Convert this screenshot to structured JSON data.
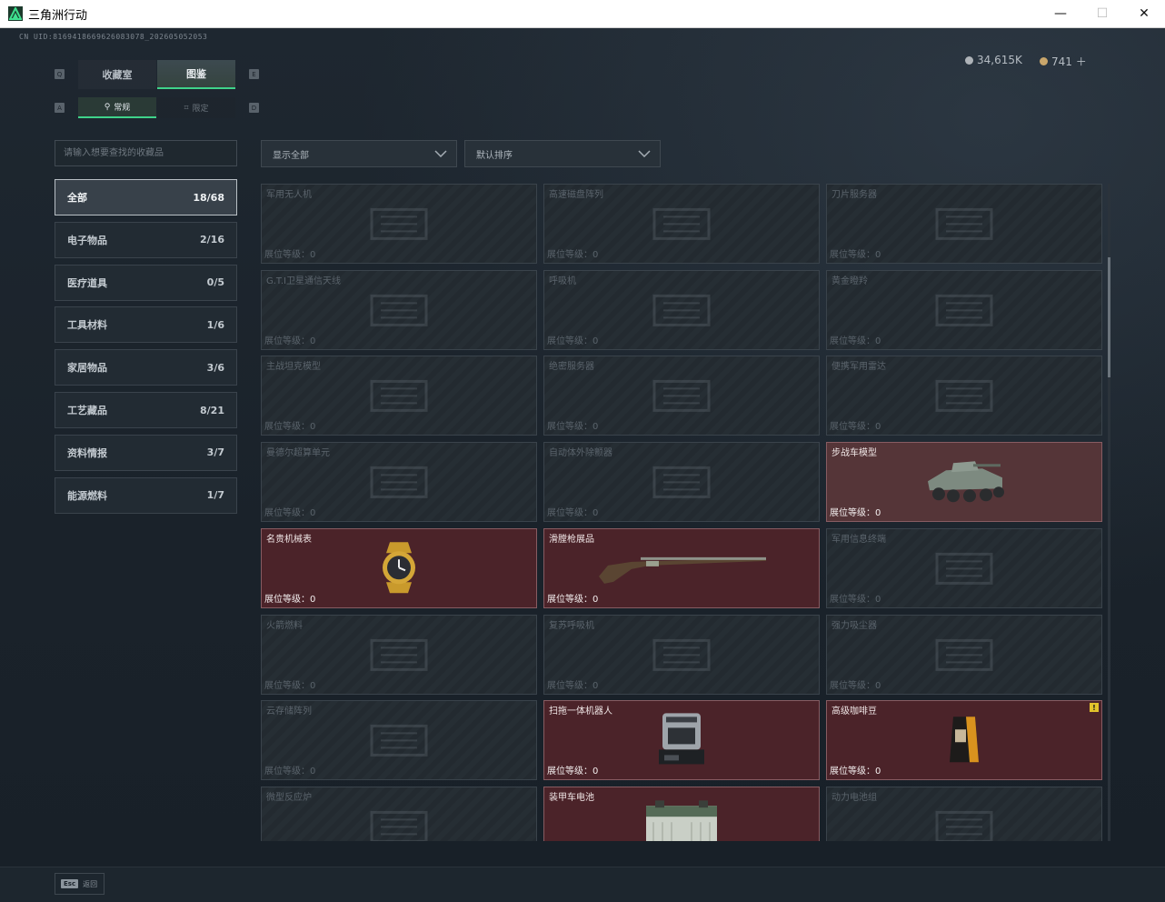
{
  "window": {
    "title": "三角洲行动",
    "minimize": "—",
    "maximize": "☐",
    "close": "✕"
  },
  "header": {
    "uid": "CN UID:8169418669626083078_202605052053",
    "tabs": [
      {
        "label": "收藏室",
        "active": false
      },
      {
        "label": "图鉴",
        "active": true
      }
    ],
    "subtabs": [
      {
        "label": "常规",
        "icon": "hanger-icon",
        "active": true
      },
      {
        "label": "限定",
        "icon": "limited-icon",
        "active": false
      }
    ],
    "key_hints": {
      "tab_left": "Q",
      "tab_right": "E",
      "sub_left": "A",
      "sub_right": "D"
    }
  },
  "currency": [
    {
      "amount": "34,615K",
      "color": "#aeb3b8"
    },
    {
      "amount": "741 ＋",
      "color": "#c9a66b"
    }
  ],
  "search": {
    "placeholder": "请输入想要查找的收藏品"
  },
  "categories": [
    {
      "label": "全部",
      "count": "18/68",
      "active": true
    },
    {
      "label": "电子物品",
      "count": "2/16",
      "active": false
    },
    {
      "label": "医疗道具",
      "count": "0/5",
      "active": false
    },
    {
      "label": "工具材料",
      "count": "1/6",
      "active": false
    },
    {
      "label": "家居物品",
      "count": "3/6",
      "active": false
    },
    {
      "label": "工艺藏品",
      "count": "8/21",
      "active": false
    },
    {
      "label": "资料情报",
      "count": "3/7",
      "active": false
    },
    {
      "label": "能源燃料",
      "count": "1/7",
      "active": false
    }
  ],
  "filters": {
    "show": "显示全部",
    "sort": "默认排序"
  },
  "level_label": "展位等级：",
  "items": [
    {
      "name": "军用无人机",
      "level": "0",
      "owned": false,
      "icon": "drone-icon"
    },
    {
      "name": "高速磁盘阵列",
      "level": "0",
      "owned": false,
      "icon": "disk-array-icon"
    },
    {
      "name": "刀片服务器",
      "level": "0",
      "owned": false,
      "icon": "blade-server-icon"
    },
    {
      "name": "G.T.I卫星通信天线",
      "level": "0",
      "owned": false,
      "icon": "satellite-dish-icon"
    },
    {
      "name": "呼吸机",
      "level": "0",
      "owned": false,
      "icon": "ventilator-icon"
    },
    {
      "name": "黄金瞪羚",
      "level": "0",
      "owned": false,
      "icon": "gazelle-statue-icon"
    },
    {
      "name": "主战坦克模型",
      "level": "0",
      "owned": false,
      "icon": "tank-model-icon"
    },
    {
      "name": "绝密服务器",
      "level": "0",
      "owned": false,
      "icon": "server-icon"
    },
    {
      "name": "便携军用雷达",
      "level": "0",
      "owned": false,
      "icon": "radar-icon"
    },
    {
      "name": "曼德尔超算单元",
      "level": "0",
      "owned": false,
      "icon": "compute-unit-icon"
    },
    {
      "name": "自动体外除颤器",
      "level": "0",
      "owned": false,
      "icon": "defibrillator-icon"
    },
    {
      "name": "步战车模型",
      "level": "0",
      "owned": true,
      "tinted": true,
      "icon": "ifv-model-icon"
    },
    {
      "name": "名贵机械表",
      "level": "0",
      "owned": true,
      "icon": "watch-icon"
    },
    {
      "name": "滑膛枪展品",
      "level": "0",
      "owned": true,
      "icon": "musket-icon"
    },
    {
      "name": "军用信息终端",
      "level": "0",
      "owned": false,
      "icon": "terminal-icon"
    },
    {
      "name": "火箭燃料",
      "level": "0",
      "owned": false,
      "icon": "rocket-fuel-icon"
    },
    {
      "name": "复苏呼吸机",
      "level": "0",
      "owned": false,
      "icon": "resuscitator-icon"
    },
    {
      "name": "强力吸尘器",
      "level": "0",
      "owned": false,
      "icon": "vacuum-icon"
    },
    {
      "name": "云存储阵列",
      "level": "0",
      "owned": false,
      "icon": "storage-array-icon"
    },
    {
      "name": "扫拖一体机器人",
      "level": "0",
      "owned": true,
      "icon": "robot-mop-icon"
    },
    {
      "name": "高级咖啡豆",
      "level": "0",
      "owned": true,
      "badge": "!",
      "icon": "coffee-bag-icon"
    },
    {
      "name": "微型反应炉",
      "level": "",
      "owned": false,
      "icon": "reactor-icon"
    },
    {
      "name": "装甲车电池",
      "level": "",
      "owned": true,
      "icon": "battery-icon"
    },
    {
      "name": "动力电池组",
      "level": "",
      "owned": false,
      "icon": "battery-pack-icon"
    }
  ],
  "footer": {
    "esc_key": "Esc",
    "esc_label": "返回"
  }
}
